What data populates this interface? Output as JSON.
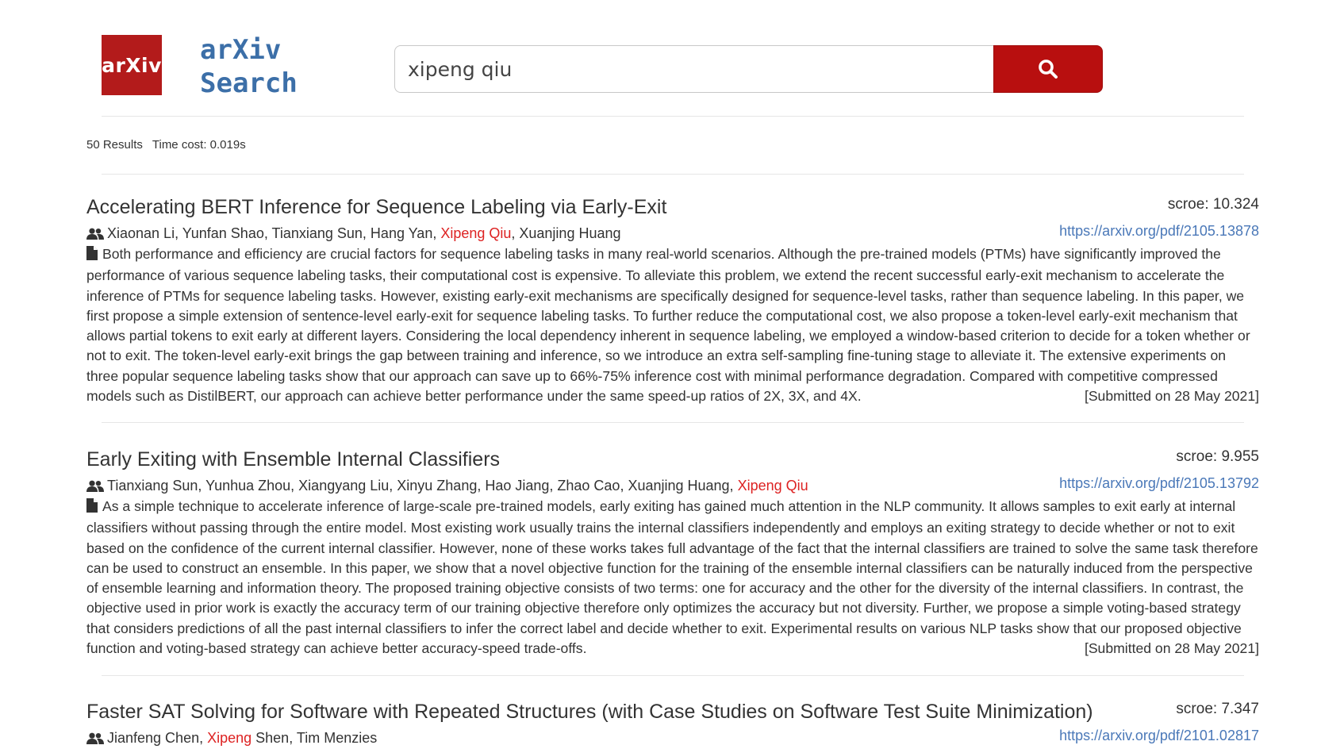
{
  "logo": {
    "badge": "arXiv",
    "line1": "arXiv",
    "line2": "Search"
  },
  "search": {
    "value": "xipeng qiu",
    "button_icon": "search-icon"
  },
  "stats": {
    "results": "50 Results",
    "time": "Time cost: 0.019s"
  },
  "colors": {
    "brand_red": "#b31b1b",
    "link_blue": "#4a78b8",
    "highlight": "#dd2222",
    "logo_text": "#3c6fa8"
  },
  "results": [
    {
      "title": "Accelerating BERT Inference for Sequence Labeling via Early-Exit",
      "score": "scroe: 10.324",
      "authors_before": "Xiaonan Li, Yunfan Shao, Tianxiang Sun, Hang Yan, ",
      "authors_highlight": "Xipeng Qiu",
      "authors_after": ", Xuanjing Huang",
      "link": "https://arxiv.org/pdf/2105.13878",
      "abstract": "Both performance and efficiency are crucial factors for sequence labeling tasks in many real-world scenarios. Although the pre-trained models (PTMs) have significantly improved the performance of various sequence labeling tasks, their computational cost is expensive. To alleviate this problem, we extend the recent successful early-exit mechanism to accelerate the inference of PTMs for sequence labeling tasks. However, existing early-exit mechanisms are specifically designed for sequence-level tasks, rather than sequence labeling. In this paper, we first propose a simple extension of sentence-level early-exit for sequence labeling tasks. To further reduce the computational cost, we also propose a token-level early-exit mechanism that allows partial tokens to exit early at different layers. Considering the local dependency inherent in sequence labeling, we employed a window-based criterion to decide for a token whether or not to exit. The token-level early-exit brings the gap between training and inference, so we introduce an extra self-sampling fine-tuning stage to alleviate it. The extensive experiments on three popular sequence labeling tasks show that our approach can save up to 66%-75% inference cost with minimal performance degradation. Compared with competitive compressed models such as DistilBERT, our approach can achieve better performance under the same speed-up ratios of 2X, 3X, and 4X.",
      "date": "[Submitted on 28 May 2021]"
    },
    {
      "title": "Early Exiting with Ensemble Internal Classifiers",
      "score": "scroe: 9.955",
      "authors_before": "Tianxiang Sun, Yunhua Zhou, Xiangyang Liu, Xinyu Zhang, Hao Jiang, Zhao Cao, Xuanjing Huang, ",
      "authors_highlight": "Xipeng Qiu",
      "authors_after": "",
      "link": "https://arxiv.org/pdf/2105.13792",
      "abstract": "As a simple technique to accelerate inference of large-scale pre-trained models, early exiting has gained much attention in the NLP community. It allows samples to exit early at internal classifiers without passing through the entire model. Most existing work usually trains the internal classifiers independently and employs an exiting strategy to decide whether or not to exit based on the confidence of the current internal classifier. However, none of these works takes full advantage of the fact that the internal classifiers are trained to solve the same task therefore can be used to construct an ensemble. In this paper, we show that a novel objective function for the training of the ensemble internal classifiers can be naturally induced from the perspective of ensemble learning and information theory. The proposed training objective consists of two terms: one for accuracy and the other for the diversity of the internal classifiers. In contrast, the objective used in prior work is exactly the accuracy term of our training objective therefore only optimizes the accuracy but not diversity. Further, we propose a simple voting-based strategy that considers predictions of all the past internal classifiers to infer the correct label and decide whether to exit. Experimental results on various NLP tasks show that our proposed objective function and voting-based strategy can achieve better accuracy-speed trade-offs.",
      "date": "[Submitted on 28 May 2021]"
    },
    {
      "title": "Faster SAT Solving for Software with Repeated Structures (with Case Studies on Software Test Suite Minimization)",
      "score": "scroe: 7.347",
      "authors_before": "Jianfeng Chen, ",
      "authors_highlight": "Xipeng",
      "authors_after": " Shen, Tim Menzies",
      "link": "https://arxiv.org/pdf/2101.02817",
      "abstract": "",
      "date": ""
    }
  ]
}
